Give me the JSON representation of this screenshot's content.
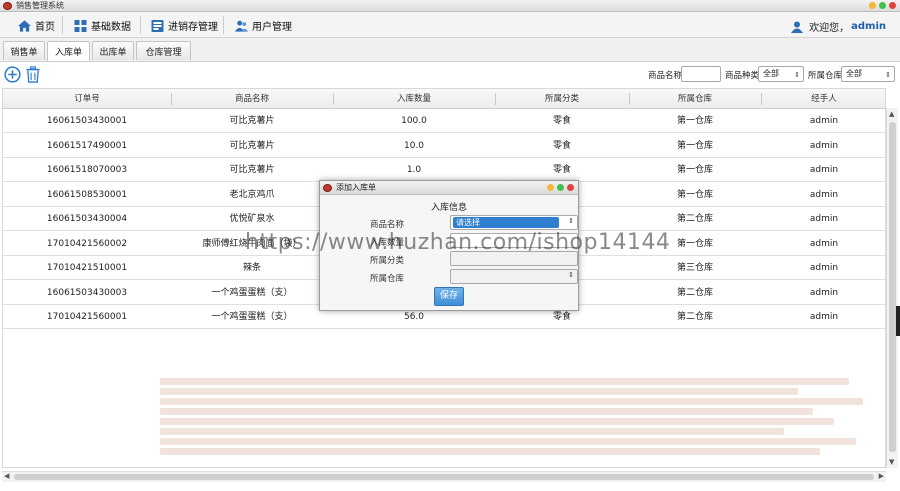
{
  "window": {
    "title": "销售管理系统"
  },
  "colors": {
    "accent": "#2f7fd0",
    "close": "#e0443e",
    "minimize": "#f2b93b",
    "maximize": "#3fbf4d"
  },
  "menu": {
    "items": [
      {
        "label": "首页",
        "icon": "home-icon"
      },
      {
        "label": "基础数据",
        "icon": "grid-icon"
      },
      {
        "label": "进销存管理",
        "icon": "inventory-icon"
      },
      {
        "label": "用户管理",
        "icon": "users-icon"
      }
    ],
    "welcome": "欢迎您，",
    "username": "admin"
  },
  "subtabs": [
    "销售单",
    "入库单",
    "出库单",
    "仓库管理"
  ],
  "active_subtab": "入库单",
  "toolbar": {
    "add_icon": "add-circle-icon",
    "delete_icon": "trash-icon",
    "filter_product_label": "商品名称",
    "filter_product_value": "",
    "filter_type_label": "商品种类",
    "filter_type_value": "全部",
    "filter_warehouse_label": "所属仓库",
    "filter_warehouse_value": "全部"
  },
  "table": {
    "columns": [
      "订单号",
      "商品名称",
      "入库数量",
      "所属分类",
      "所属仓库",
      "经手人"
    ],
    "rows": [
      [
        "16061503430001",
        "可比克薯片",
        "100.0",
        "零食",
        "第一仓库",
        "admin"
      ],
      [
        "16061517490001",
        "可比克薯片",
        "10.0",
        "零食",
        "第一仓库",
        "admin"
      ],
      [
        "16061518070003",
        "可比克薯片",
        "1.0",
        "零食",
        "第一仓库",
        "admin"
      ],
      [
        "16061508530001",
        "老北京鸡爪",
        "",
        "",
        "第一仓库",
        "admin"
      ],
      [
        "16061503430004",
        "优悦矿泉水",
        "",
        "",
        "第二仓库",
        "admin"
      ],
      [
        "17010421560002",
        "康师傅红烧牛肉面（袋）",
        "",
        "",
        "第一仓库",
        "admin"
      ],
      [
        "17010421510001",
        "辣条",
        "",
        "",
        "第三仓库",
        "admin"
      ],
      [
        "16061503430003",
        "一个鸡蛋蛋糕（支）",
        "",
        "",
        "第二仓库",
        "admin"
      ],
      [
        "17010421560001",
        "一个鸡蛋蛋糕（支）",
        "56.0",
        "零食",
        "第二仓库",
        "admin"
      ]
    ]
  },
  "dialog": {
    "title": "添加入库单",
    "heading": "入库信息",
    "product_label": "商品名称",
    "product_value": "请选择",
    "quantity_label": "入库数量",
    "quantity_value": "",
    "category_label": "所属分类",
    "category_value": "",
    "warehouse_label": "所属仓库",
    "warehouse_value": "",
    "save_label": "保存"
  },
  "watermark": "https://www.huzhan.com/ishop14144"
}
